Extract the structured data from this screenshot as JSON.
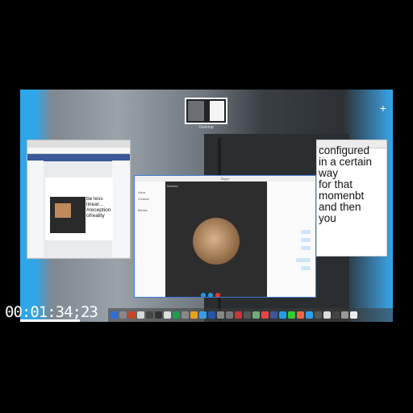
{
  "desktop": {
    "space_label": "Desktop",
    "add_space": "+"
  },
  "facebook_window": {
    "card_text": "be less linear... #reception ofreality"
  },
  "skype_window": {
    "title": "Skype",
    "contact_name": "Bandau",
    "sidebar_items": [
      "Home",
      "Contacts",
      "Bandau"
    ]
  },
  "notes_window": {
    "text_lines": [
      "configured",
      "in a certain",
      "way",
      "for that",
      "momenbt",
      "and then",
      "you"
    ]
  },
  "dock": {
    "icon_colors": [
      "#2d6fd8",
      "#888",
      "#cc4422",
      "#d8d8d8",
      "#444",
      "#333",
      "#ddd",
      "#1a9e4c",
      "#888",
      "#e6a020",
      "#3a9be0",
      "#25a",
      "#888",
      "#777",
      "#c33",
      "#555",
      "#7a7",
      "#e44",
      "#3b5998",
      "#1fa0e6",
      "#3c3",
      "#e64",
      "#2aa0e8",
      "#555",
      "#ddd",
      "#444",
      "#999",
      "#eee"
    ]
  },
  "video": {
    "timecode": "00:01:34;23",
    "progress_fraction": 0.16
  }
}
